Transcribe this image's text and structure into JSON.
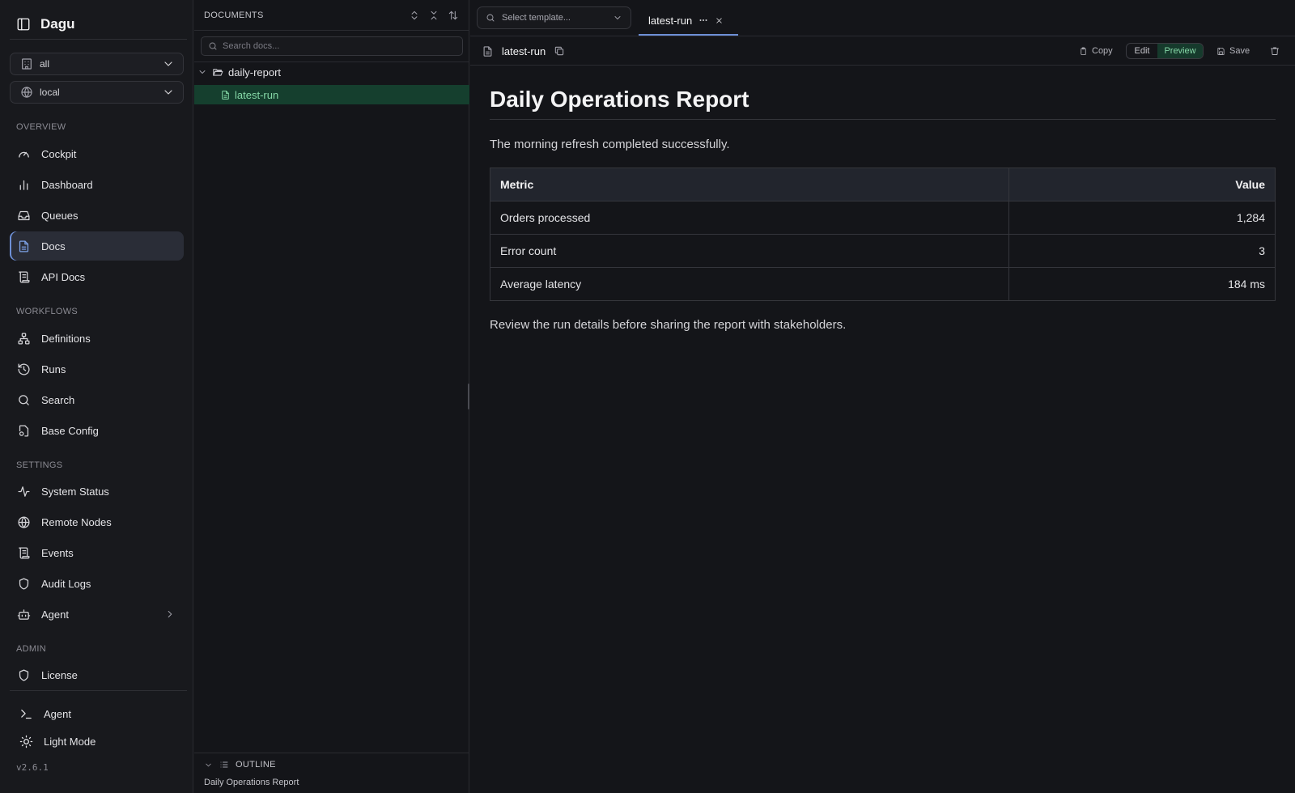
{
  "app": {
    "title": "Dagu",
    "version": "v2.6.1"
  },
  "sidebar": {
    "workspace_select": "all",
    "node_select": "local",
    "sections": {
      "overview": "OVERVIEW",
      "workflows": "WORKFLOWS",
      "settings": "SETTINGS",
      "admin": "ADMIN"
    },
    "items": {
      "cockpit": "Cockpit",
      "dashboard": "Dashboard",
      "queues": "Queues",
      "docs": "Docs",
      "api_docs": "API Docs",
      "definitions": "Definitions",
      "runs": "Runs",
      "search": "Search",
      "base_config": "Base Config",
      "system_status": "System Status",
      "remote_nodes": "Remote Nodes",
      "events": "Events",
      "audit_logs": "Audit Logs",
      "agent": "Agent",
      "license": "License"
    },
    "footer": {
      "agent": "Agent",
      "theme": "Light Mode"
    }
  },
  "documents": {
    "title": "DOCUMENTS",
    "search_placeholder": "Search docs...",
    "tree": {
      "folder": "daily-report",
      "file": "latest-run"
    },
    "outline": {
      "title": "OUTLINE",
      "item": "Daily Operations Report"
    }
  },
  "main": {
    "template_placeholder": "Select template...",
    "tab_label": "latest-run",
    "doc_name": "latest-run",
    "toolbar": {
      "copy": "Copy",
      "edit": "Edit",
      "preview": "Preview",
      "save": "Save"
    },
    "doc": {
      "heading": "Daily Operations Report",
      "intro": "The morning refresh completed successfully.",
      "table": {
        "headers": [
          "Metric",
          "Value"
        ],
        "rows": [
          [
            "Orders processed",
            "1,284"
          ],
          [
            "Error count",
            "3"
          ],
          [
            "Average latency",
            "184 ms"
          ]
        ]
      },
      "outro": "Review the run details before sharing the report with stakeholders."
    }
  },
  "colors": {
    "accent": "#6d8fd6",
    "selected_green": "#86d9a8",
    "background": "#141519"
  }
}
